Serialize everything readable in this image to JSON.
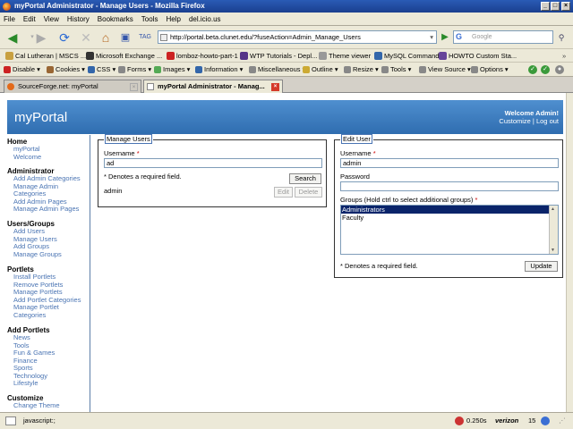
{
  "window": {
    "title": "myPortal Administrator - Manage Users - Mozilla Firefox",
    "min": "_",
    "max": "□",
    "close": "×"
  },
  "menu": [
    "File",
    "Edit",
    "View",
    "History",
    "Bookmarks",
    "Tools",
    "Help",
    "del.icio.us"
  ],
  "nav": {
    "url": "http://portal.beta.clunet.edu/?fuseAction=Admin_Manage_Users",
    "search_placeholder": "Google",
    "search_engine_glyph": "G"
  },
  "bookmarks": [
    {
      "label": "Cal Lutheran | MSCS ...",
      "color": "#c8a040"
    },
    {
      "label": "Microsoft Exchange ...",
      "color": "#333333"
    },
    {
      "label": "lomboz-howto-part-1",
      "color": "#cc2222"
    },
    {
      "label": "WTP Tutorials - Depl...",
      "color": "#553388"
    },
    {
      "label": "Theme viewer",
      "color": "#999999"
    },
    {
      "label": "MySQL Commands",
      "color": "#3366aa"
    },
    {
      "label": "HOWTO Custom Sta...",
      "color": "#664499"
    }
  ],
  "devbar": [
    {
      "label": "Disable ▾",
      "color": "#cc2222"
    },
    {
      "label": "Cookies ▾",
      "color": "#996633"
    },
    {
      "label": "CSS ▾",
      "color": "#3366aa"
    },
    {
      "label": "Forms ▾",
      "color": "#888888"
    },
    {
      "label": "Images ▾",
      "color": "#55aa55"
    },
    {
      "label": "Information ▾",
      "color": "#3366aa"
    },
    {
      "label": "Miscellaneous ▾",
      "color": "#888888"
    },
    {
      "label": "Outline ▾",
      "color": "#ccaa33"
    },
    {
      "label": "Resize ▾",
      "color": "#888888"
    },
    {
      "label": "Tools ▾",
      "color": "#888888"
    },
    {
      "label": "View Source ▾",
      "color": "#888888"
    },
    {
      "label": "Options ▾",
      "color": "#888888"
    }
  ],
  "tabs": [
    {
      "label": "SourceForge.net: myPortal",
      "active": false
    },
    {
      "label": "myPortal Administrator - Manag...",
      "active": true
    }
  ],
  "header": {
    "logo": "myPortal",
    "welcome": "Welcome Admin!",
    "customize": "Customize",
    "separator": " | ",
    "logout": "Log out"
  },
  "sidebar": [
    {
      "title": "Home",
      "links": [
        "myPortal",
        "Welcome"
      ]
    },
    {
      "title": "Administrator",
      "links": [
        "Add Admin Categories",
        "Manage Admin",
        "Categories",
        "Add Admin Pages",
        "Manage Admin Pages"
      ]
    },
    {
      "title": "Users/Groups",
      "links": [
        "Add Users",
        "Manage Users",
        "Add Groups",
        "Manage Groups"
      ]
    },
    {
      "title": "Portlets",
      "links": [
        "Install Portlets",
        "Remove Portlets",
        "Manage Portlets",
        "Add Portlet Categories",
        "Manage Portlet",
        "Categories"
      ]
    },
    {
      "title": "Add Portlets",
      "links": [
        "News",
        "Tools",
        "Fun & Games",
        "Finance",
        "Sports",
        "Technology",
        "Lifestyle"
      ]
    },
    {
      "title": "Customize",
      "links": [
        "Change Theme"
      ]
    }
  ],
  "manage_users": {
    "legend": "Manage Users",
    "username_label": "Username",
    "required_mark": "*",
    "username_value": "ad",
    "required_note": "* Denotes a required field.",
    "search_label": "Search",
    "result_user": "admin",
    "edit_label": "Edit",
    "delete_label": "Delete"
  },
  "edit_user": {
    "legend": "Edit User",
    "username_label": "Username",
    "required_mark": "*",
    "username_value": "admin",
    "password_label": "Password",
    "password_value": "",
    "groups_label": "Groups (Hold ctrl to select additional groups)",
    "groups": [
      {
        "label": "Administrators",
        "selected": true
      },
      {
        "label": "Faculty",
        "selected": false
      }
    ],
    "required_note": "* Denotes a required field.",
    "update_label": "Update"
  },
  "status": {
    "text": "javascript:;",
    "timing": "0.250s",
    "carrier": "verizon",
    "carrier_num": "15"
  }
}
